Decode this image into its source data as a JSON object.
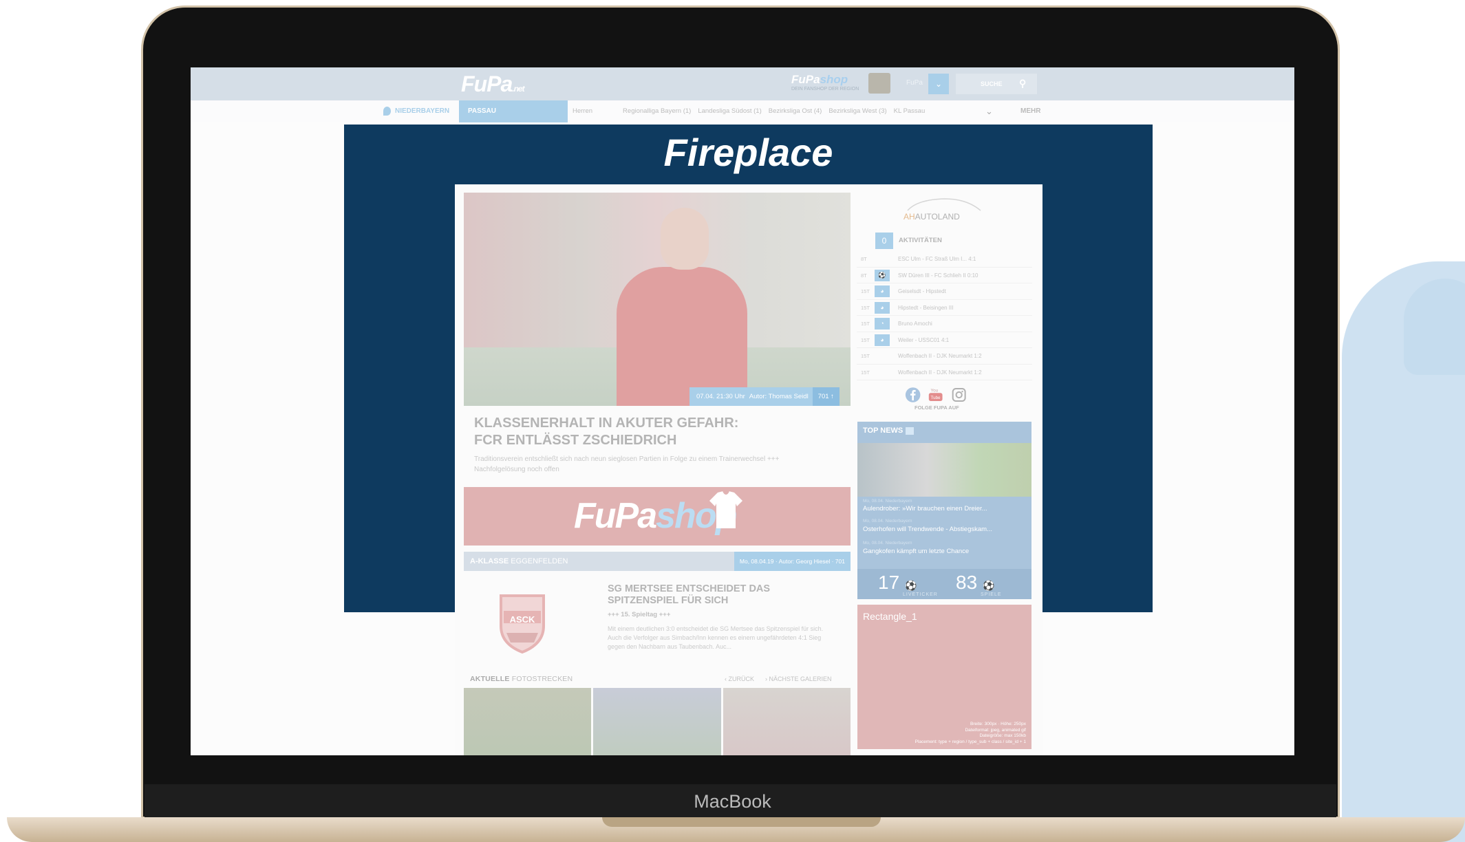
{
  "device_label": "MacBook",
  "header": {
    "logo": "FuPa",
    "logo_suffix": ".net",
    "shop_logo_a": "FuPa",
    "shop_logo_b": "shop",
    "shop_tagline": "DEIN FANSHOP DER REGION",
    "user_name": "FuPa",
    "search_label": "SUCHE",
    "icons": {
      "user_dropdown": "chevron-down-icon",
      "search": "search-icon"
    }
  },
  "nav": {
    "region": "NIEDERBAYERN",
    "active": "PASSAU",
    "links": [
      "Herren",
      "Regionalliga Bayern (1)",
      "Landesliga Südost (1)",
      "Bezirksliga Ost (4)",
      "Bezirksliga West (3)",
      "KL Passau"
    ],
    "more": "MEHR"
  },
  "fireplace": {
    "title": "Fireplace",
    "color": "#0e3a5f"
  },
  "main_article": {
    "caption_date": "07.04. 21:30 Uhr",
    "caption_author": "Autor: Thomas Seidl",
    "caption_count": "701",
    "headline_line1": "KLASSENERHALT IN AKUTER GEFAHR:",
    "headline_line2": "FCR ENTLÄSST ZSCHIEDRICH",
    "teaser": "Traditionsverein entschließt sich nach neun sieglosen Partien in Folge zu einem Trainerwechsel +++ Nachfolgelösung noch offen"
  },
  "shop_banner": {
    "part1": "FuPa",
    "part2": "shop"
  },
  "league_article": {
    "league_bold": "A-KLASSE",
    "league_rest": "EGGENFELDEN",
    "meta": "Mo, 08.04.19 · Autor: Georg Hiesel · 701",
    "club": "ASCK",
    "title": "SG MERTSEE ENTSCHEIDET DAS SPITZENSPIEL FÜR SICH",
    "subtitle": "+++ 15. Spieltag +++",
    "text": "Mit einem deutlichen 3:0 entscheidet die SG Mertsee das Spitzenspiel für sich. Auch die Verfolger aus Simbach/Inn kennen es einem ungefährdeten 4:1 Sieg gegen den Nachbarn aus Taubenbach. Auc..."
  },
  "gallery": {
    "label_bold": "AKTUELLE",
    "label_rest": "FOTOSTRECKEN",
    "back": "‹ ZURÜCK",
    "next": "› NÄCHSTE GALERIEN"
  },
  "sidebar": {
    "sponsor": "AUTOLAND",
    "sponsor_prefix": "AH",
    "activities_count": "0",
    "activities_title": "AKTIVITÄTEN",
    "activities": [
      {
        "time": "8T",
        "icon": "",
        "text": "ESC Ulm - FC Straß Ulm I... 4:1"
      },
      {
        "time": "8T",
        "icon": "⚽",
        "text": "SW Düren III - FC Schlieh II 0:10"
      },
      {
        "time": "15T",
        "icon": "◕",
        "text": "Geiselsdt - Hipstedt"
      },
      {
        "time": "15T",
        "icon": "◕",
        "text": "Hipstedt - Beisingen III"
      },
      {
        "time": "15T",
        "icon": "◔",
        "text": "Bruno Amochi"
      },
      {
        "time": "15T",
        "icon": "◕",
        "text": "Weiler - USSC01 4:1"
      },
      {
        "time": "15T",
        "icon": "",
        "text": "Woffenbach II - DJK Neumarkt 1:2"
      },
      {
        "time": "15T",
        "icon": "",
        "text": "Woffenbach II - DJK Neumarkt 1:2"
      }
    ],
    "social_caption": "FOLGE FUPA AUF",
    "social_icons": [
      "facebook-icon",
      "youtube-icon",
      "instagram-icon"
    ],
    "topnews_title": "TOP NEWS",
    "topnews": [
      {
        "meta": "Mo, 08.04. Niederbayern",
        "text": "Aulendrober: »Wir brauchen einen Dreier..."
      },
      {
        "meta": "Mo, 08.04. Niederbayern",
        "text": "Osterhofen will Trendwende - Abstiegskam..."
      },
      {
        "meta": "Mo, 08.04. Niederbayern",
        "text": "Gangkofen kämpft um letzte Chance"
      }
    ],
    "stat_live": "17",
    "stat_live_label": "LIVETICKER",
    "stat_games": "83",
    "stat_games_label": "SPIELE",
    "ad_title": "Rectangle_1",
    "ad_info": [
      "Breite: 300px · Höhe: 250px",
      "Dateiformat: jpeg, animated gif",
      "Dateigröße: max 150kb",
      "Placement: type + region / type_sub + class / site_id + 1"
    ]
  }
}
